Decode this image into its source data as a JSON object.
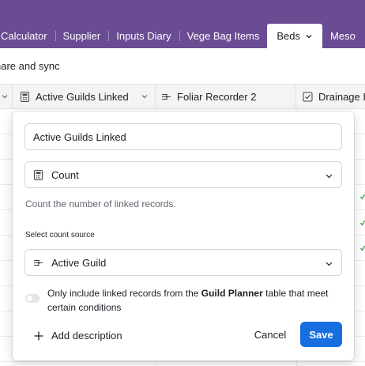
{
  "tabs": [
    {
      "label": "Calculator",
      "active": false
    },
    {
      "label": "Supplier",
      "active": false
    },
    {
      "label": "Inputs Diary",
      "active": false
    },
    {
      "label": "Vege Bag Items",
      "active": false
    },
    {
      "label": "Beds",
      "active": true
    },
    {
      "label": "Meso",
      "active": false
    }
  ],
  "toolbar": {
    "share_label": "hare and sync"
  },
  "columns": [
    {
      "label": "Active Guilds Linked",
      "icon": "count-icon"
    },
    {
      "label": "Foliar Recorder 2",
      "icon": "link-icon"
    },
    {
      "label": "Drainage I",
      "icon": "checkbox-icon"
    }
  ],
  "popover": {
    "field_name": "Active Guilds Linked",
    "field_type": "Count",
    "description": "Count the number of linked records.",
    "source_label": "Select count source",
    "source_value": "Active Guild",
    "condition_prefix": "Only include linked records from the ",
    "condition_table": "Guild Planner",
    "condition_suffix": " table that meet certain conditions",
    "condition_enabled": false,
    "add_description_label": "Add description",
    "cancel_label": "Cancel",
    "save_label": "Save"
  },
  "colors": {
    "topbar": "#6a4c93",
    "primary": "#166ee1",
    "check": "#2e9e44"
  }
}
